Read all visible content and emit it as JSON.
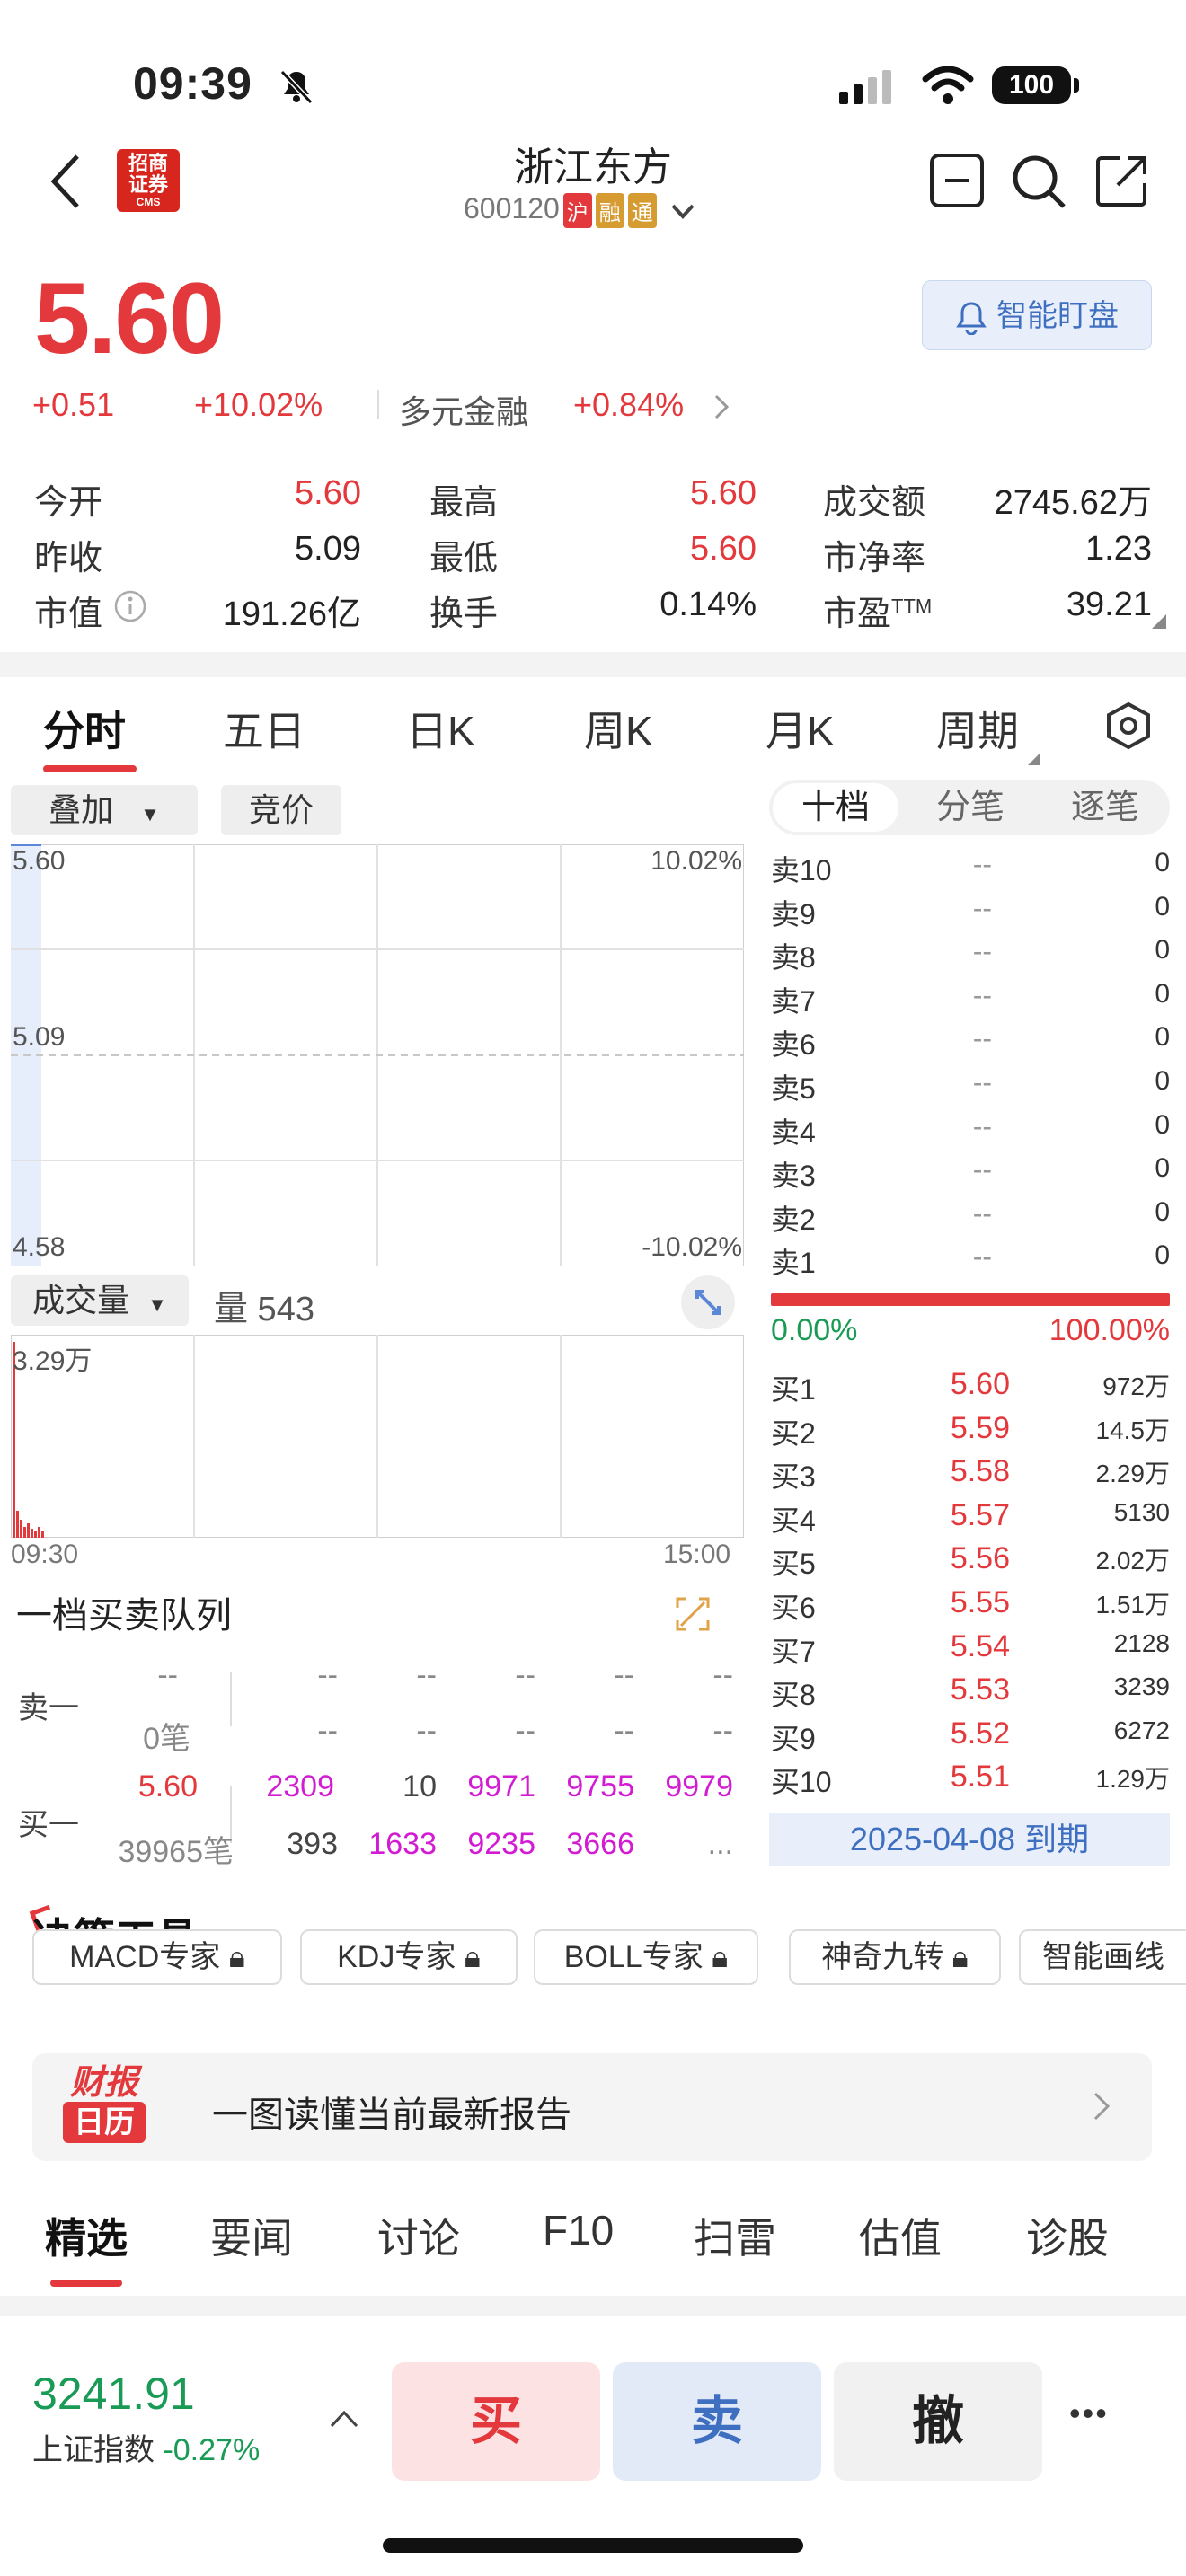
{
  "status": {
    "time": "09:39",
    "battery": "100"
  },
  "header": {
    "name": "浙江东方",
    "code": "600120",
    "tag_hu": "沪",
    "tag_rong": "融",
    "tag_tong": "通",
    "logo_line1": "招商",
    "logo_line2": "证券",
    "logo_sub": "CMS"
  },
  "price": {
    "last": "5.60",
    "change": "+0.51",
    "pct": "+10.02%",
    "sector": "多元金融",
    "sector_pct": "+0.84%",
    "watch_label": "智能盯盘"
  },
  "stats": {
    "open_label": "今开",
    "open": "5.60",
    "high_label": "最高",
    "high": "5.60",
    "turnover_amt_label": "成交额",
    "turnover_amt": "2745.62万",
    "prev_label": "昨收",
    "prev": "5.09",
    "low_label": "最低",
    "low": "5.60",
    "pb_label": "市净率",
    "pb": "1.23",
    "mcap_label": "市值",
    "mcap": "191.26亿",
    "turnover_label": "换手",
    "turnover": "0.14%",
    "pe_label": "市盈",
    "pe_sup": "TTM",
    "pe": "39.21"
  },
  "chart_tabs": [
    "分时",
    "五日",
    "日K",
    "周K",
    "月K",
    "周期"
  ],
  "chart": {
    "overlay_label": "叠加",
    "auction_label": "竞价",
    "y_top": "5.60",
    "y_mid": "5.09",
    "y_bot": "4.58",
    "pct_top": "10.02%",
    "pct_bot": "-10.02%",
    "volume_label": "成交量",
    "volume_readout": "量 543",
    "vol_max": "3.29万",
    "time_start": "09:30",
    "time_end": "15:00"
  },
  "depth": {
    "tabs": [
      "十档",
      "分笔",
      "逐笔"
    ],
    "asks": [
      {
        "label": "卖10",
        "price": "--",
        "vol": "0"
      },
      {
        "label": "卖9",
        "price": "--",
        "vol": "0"
      },
      {
        "label": "卖8",
        "price": "--",
        "vol": "0"
      },
      {
        "label": "卖7",
        "price": "--",
        "vol": "0"
      },
      {
        "label": "卖6",
        "price": "--",
        "vol": "0"
      },
      {
        "label": "卖5",
        "price": "--",
        "vol": "0"
      },
      {
        "label": "卖4",
        "price": "--",
        "vol": "0"
      },
      {
        "label": "卖3",
        "price": "--",
        "vol": "0"
      },
      {
        "label": "卖2",
        "price": "--",
        "vol": "0"
      },
      {
        "label": "卖1",
        "price": "--",
        "vol": "0"
      }
    ],
    "ratio_left": "0.00%",
    "ratio_right": "100.00%",
    "bids": [
      {
        "label": "买1",
        "price": "5.60",
        "vol": "972万"
      },
      {
        "label": "买2",
        "price": "5.59",
        "vol": "14.5万"
      },
      {
        "label": "买3",
        "price": "5.58",
        "vol": "2.29万"
      },
      {
        "label": "买4",
        "price": "5.57",
        "vol": "5130"
      },
      {
        "label": "买5",
        "price": "5.56",
        "vol": "2.02万"
      },
      {
        "label": "买6",
        "price": "5.55",
        "vol": "1.51万"
      },
      {
        "label": "买7",
        "price": "5.54",
        "vol": "2128"
      },
      {
        "label": "买8",
        "price": "5.53",
        "vol": "3239"
      },
      {
        "label": "买9",
        "price": "5.52",
        "vol": "6272"
      },
      {
        "label": "买10",
        "price": "5.51",
        "vol": "1.29万"
      }
    ],
    "expiry": "2025-04-08 到期"
  },
  "queue": {
    "title": "一档买卖队列",
    "sell_label": "卖一",
    "buy_label": "买一",
    "sell_row1": [
      "--",
      "--",
      "--",
      "--",
      "--",
      "--"
    ],
    "sell_row2": [
      "0笔",
      "--",
      "--",
      "--",
      "--",
      "--"
    ],
    "buy_row1": [
      "5.60",
      "2309",
      "10",
      "9971",
      "9755",
      "9979"
    ],
    "buy_row2": [
      "39965笔",
      "393",
      "1633",
      "9235",
      "3666",
      "..."
    ]
  },
  "tools": {
    "title": "决策工具",
    "chips": [
      "MACD专家",
      "KDJ专家",
      "BOLL专家",
      "神奇九转",
      "智能画线"
    ]
  },
  "report": {
    "logo_top": "财报",
    "logo_bottom": "日历",
    "text": "一图读懂当前最新报告"
  },
  "bottom_tabs": [
    "精选",
    "要闻",
    "讨论",
    "F10",
    "扫雷",
    "估值",
    "诊股"
  ],
  "footer": {
    "index_value": "3241.91",
    "index_name": "上证指数",
    "index_pct": "-0.27%",
    "buy": "买",
    "sell": "卖",
    "cancel": "撤",
    "more": "•••"
  },
  "colors": {
    "up": "#e4393c",
    "down": "#1a9b55",
    "accent": "#3f6fc1"
  },
  "chart_data": {
    "type": "line",
    "y_ticks": [
      5.6,
      5.09,
      4.58
    ],
    "pct_ticks": [
      "10.02%",
      "-10.02%"
    ],
    "ylim": [
      4.58,
      5.6
    ],
    "volume_max": "3.29万",
    "x_range": [
      "09:30",
      "15:00"
    ]
  }
}
